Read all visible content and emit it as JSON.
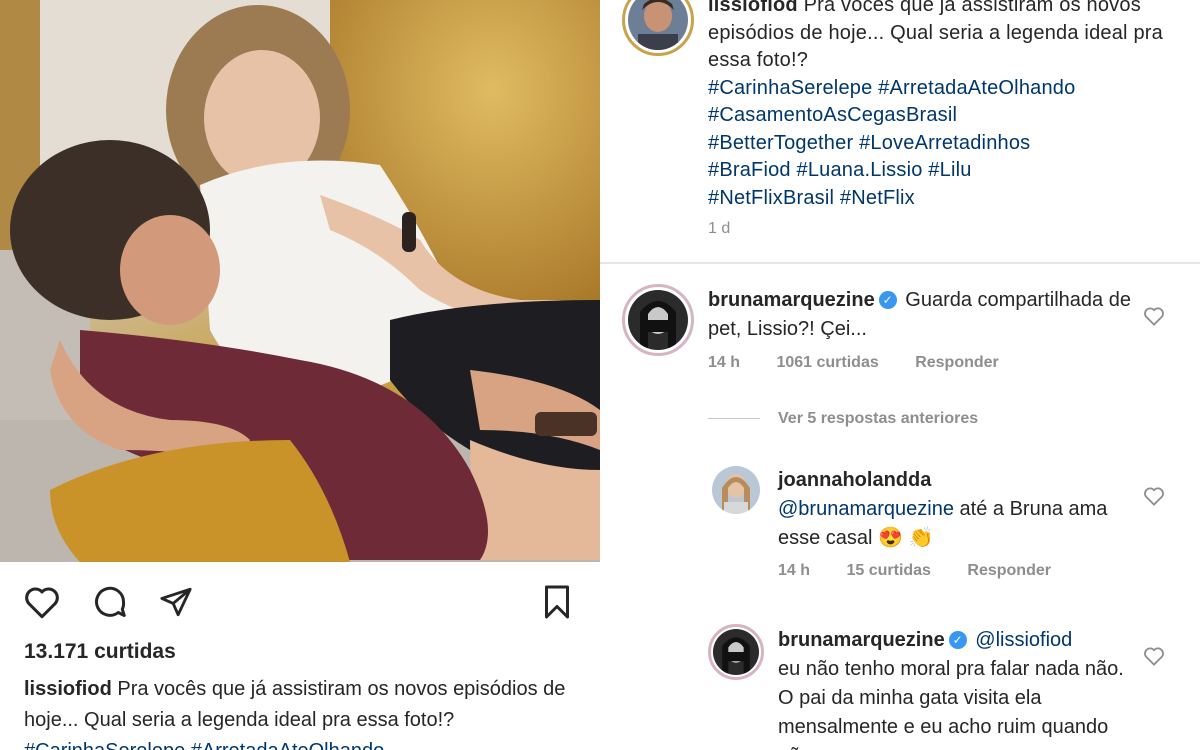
{
  "post": {
    "likes_text": "13.171 curtidas",
    "username": "lissiofiod",
    "caption_text": "Pra vocês que já assistiram os novos episódios de hoje... Qual seria a legenda ideal pra essa foto!?",
    "caption_tags_inline": "#CarinhaSerelepe #ArretadaAteOlhando",
    "hashtag_lines": [
      "#CarinhaSerelepe #ArretadaAteOlhando",
      "#CasamentoAsCegasBrasil",
      "#BetterTogether #LoveArretadinhos",
      "#BraFiod #Luana.Lissio #Lilu",
      "#NetFlixBrasil #NetFlix"
    ],
    "age": "1 d"
  },
  "icons": {
    "like": "heart-icon",
    "comment": "comment-icon",
    "share": "send-icon",
    "save": "bookmark-icon"
  },
  "comments": [
    {
      "username": "bruna­marquezine",
      "verified": true,
      "text": "Guarda compartilhada de pet, Lissio?! Çei...",
      "time": "14 h",
      "likes": "1061 curtidas",
      "reply": "Responder"
    },
    {
      "username": "joannaholandda",
      "verified": false,
      "mention": "@brunamarquezine",
      "text": "até a Bruna ama esse casal",
      "emoji": "😍 👏",
      "time": "14 h",
      "likes": "15 curtidas",
      "reply": "Responder"
    },
    {
      "username": "brunamarquezine",
      "verified": true,
      "mention": "@lissiofiod",
      "text": "eu não tenho moral pra falar nada não. O pai da minha gata visita ela mensalmente e eu acho ruim quando não vem"
    }
  ],
  "view_replies": "Ver 5 respostas anteriores",
  "colors": {
    "hashtag": "#00376b",
    "muted": "#8e8e8e",
    "verified": "#3897f0",
    "text": "#262626"
  }
}
